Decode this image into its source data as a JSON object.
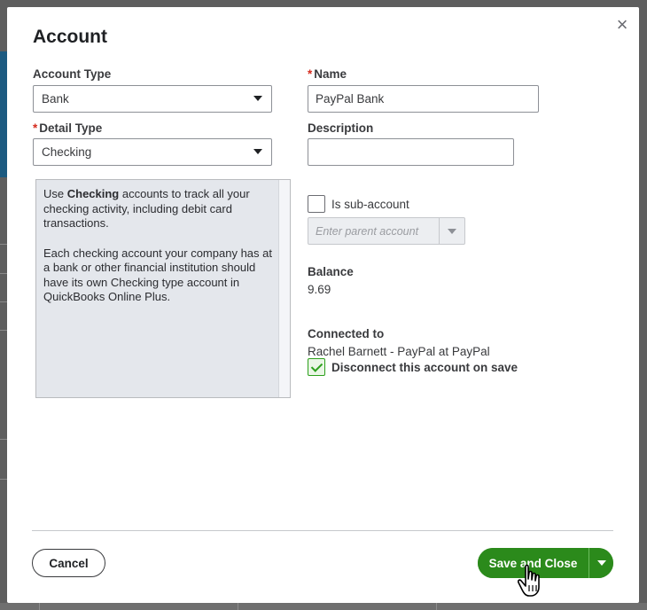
{
  "dialog": {
    "title": "Account",
    "close_glyph": "×"
  },
  "form": {
    "account_type": {
      "label": "Account Type",
      "value": "Bank"
    },
    "detail_type": {
      "required_mark": "*",
      "label": "Detail Type",
      "value": "Checking"
    },
    "name": {
      "required_mark": "*",
      "label": "Name",
      "value": "PayPal Bank"
    },
    "description": {
      "label": "Description",
      "value": ""
    },
    "help": {
      "p1_prefix": "Use ",
      "p1_bold": "Checking",
      "p1_suffix": " accounts to track all your checking activity, including debit card transactions.",
      "p2": "Each checking account your company has at a bank or other financial institution should have its own Checking type account in QuickBooks Online Plus."
    },
    "sub_account": {
      "label": "Is sub-account",
      "checked": false,
      "parent_placeholder": "Enter parent account"
    },
    "balance": {
      "label": "Balance",
      "value": "9.69"
    },
    "connected": {
      "label": "Connected to",
      "value": "Rachel Barnett - PayPal at PayPal",
      "disconnect_label": "Disconnect this account on save",
      "disconnect_checked": true
    }
  },
  "footer": {
    "cancel_label": "Cancel",
    "save_label": "Save and Close"
  },
  "colors": {
    "primary_green": "#2c8a1a",
    "required_red": "#d52b1e",
    "check_green": "#2ca01c"
  },
  "icons": {
    "close": "close-icon",
    "dropdown": "chevron-down-icon",
    "cursor": "pointer-hand-icon"
  }
}
